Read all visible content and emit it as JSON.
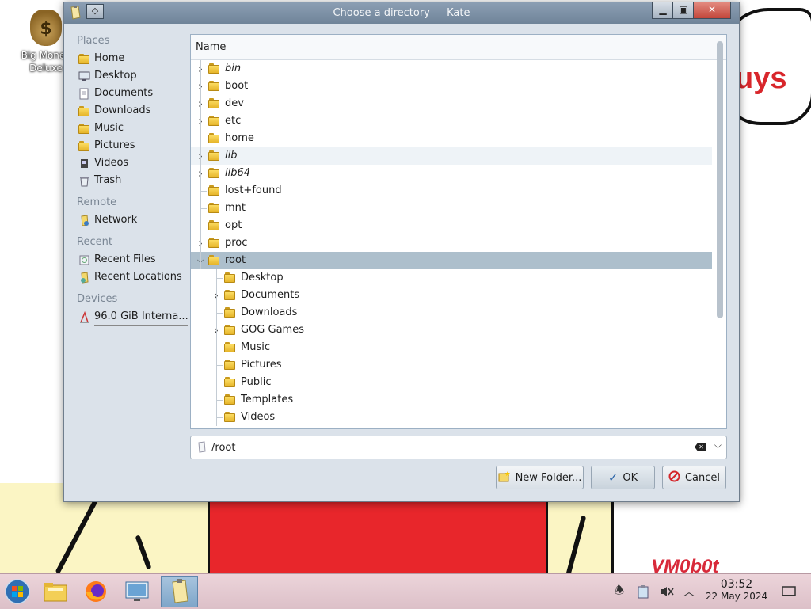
{
  "desktop": {
    "icon_label": "Big Money Deluxe",
    "wallpaper_text": "uys",
    "wallpaper_signature": "VM0b0t"
  },
  "dialog": {
    "title": "Choose a directory — Kate",
    "places": {
      "sections": [
        {
          "label": "Places",
          "items": [
            {
              "label": "Home",
              "icon": "home-folder-icon"
            },
            {
              "label": "Desktop",
              "icon": "desktop-icon"
            },
            {
              "label": "Documents",
              "icon": "documents-folder-icon"
            },
            {
              "label": "Downloads",
              "icon": "downloads-folder-icon"
            },
            {
              "label": "Music",
              "icon": "music-folder-icon"
            },
            {
              "label": "Pictures",
              "icon": "pictures-folder-icon"
            },
            {
              "label": "Videos",
              "icon": "videos-folder-icon"
            },
            {
              "label": "Trash",
              "icon": "trash-icon"
            }
          ]
        },
        {
          "label": "Remote",
          "items": [
            {
              "label": "Network",
              "icon": "network-folder-icon"
            }
          ]
        },
        {
          "label": "Recent",
          "items": [
            {
              "label": "Recent Files",
              "icon": "recent-files-icon"
            },
            {
              "label": "Recent Locations",
              "icon": "recent-locations-icon"
            }
          ]
        },
        {
          "label": "Devices",
          "items": [
            {
              "label": "96.0 GiB Interna...",
              "icon": "hard-drive-icon"
            }
          ]
        }
      ]
    },
    "tree": {
      "header": "Name",
      "rows": [
        {
          "label": "bin",
          "depth": 0,
          "arrow": "right",
          "italic": true
        },
        {
          "label": "boot",
          "depth": 0,
          "arrow": "right",
          "italic": false
        },
        {
          "label": "dev",
          "depth": 0,
          "arrow": "right",
          "italic": false
        },
        {
          "label": "etc",
          "depth": 0,
          "arrow": "right",
          "italic": false
        },
        {
          "label": "home",
          "depth": 0,
          "arrow": "none",
          "italic": false
        },
        {
          "label": "lib",
          "depth": 0,
          "arrow": "right",
          "italic": true,
          "state": "hover"
        },
        {
          "label": "lib64",
          "depth": 0,
          "arrow": "right",
          "italic": true
        },
        {
          "label": "lost+found",
          "depth": 0,
          "arrow": "none",
          "italic": false
        },
        {
          "label": "mnt",
          "depth": 0,
          "arrow": "none",
          "italic": false
        },
        {
          "label": "opt",
          "depth": 0,
          "arrow": "none",
          "italic": false
        },
        {
          "label": "proc",
          "depth": 0,
          "arrow": "right",
          "italic": false
        },
        {
          "label": "root",
          "depth": 0,
          "arrow": "down",
          "italic": false,
          "state": "selected"
        },
        {
          "label": "Desktop",
          "depth": 1,
          "arrow": "none",
          "italic": false
        },
        {
          "label": "Documents",
          "depth": 1,
          "arrow": "right",
          "italic": false
        },
        {
          "label": "Downloads",
          "depth": 1,
          "arrow": "none",
          "italic": false
        },
        {
          "label": "GOG Games",
          "depth": 1,
          "arrow": "right",
          "italic": false
        },
        {
          "label": "Music",
          "depth": 1,
          "arrow": "none",
          "italic": false
        },
        {
          "label": "Pictures",
          "depth": 1,
          "arrow": "none",
          "italic": false
        },
        {
          "label": "Public",
          "depth": 1,
          "arrow": "none",
          "italic": false
        },
        {
          "label": "Templates",
          "depth": 1,
          "arrow": "none",
          "italic": false
        },
        {
          "label": "Videos",
          "depth": 1,
          "arrow": "none",
          "italic": false
        }
      ]
    },
    "path": {
      "value": "/root"
    },
    "buttons": {
      "new_folder": "New Folder...",
      "ok": "OK",
      "cancel": "Cancel"
    }
  },
  "taskbar": {
    "apps": [
      "start-menu-icon",
      "file-manager-icon",
      "firefox-icon",
      "system-settings-icon",
      "kate-icon"
    ],
    "clock": {
      "time": "03:52",
      "date": "22 May 2024"
    }
  },
  "colors": {
    "selection": "#adbfcc",
    "titlebar": "#7b8fa4",
    "dialog_bg": "#dbe2ea",
    "taskbar": "#e4cad1"
  }
}
